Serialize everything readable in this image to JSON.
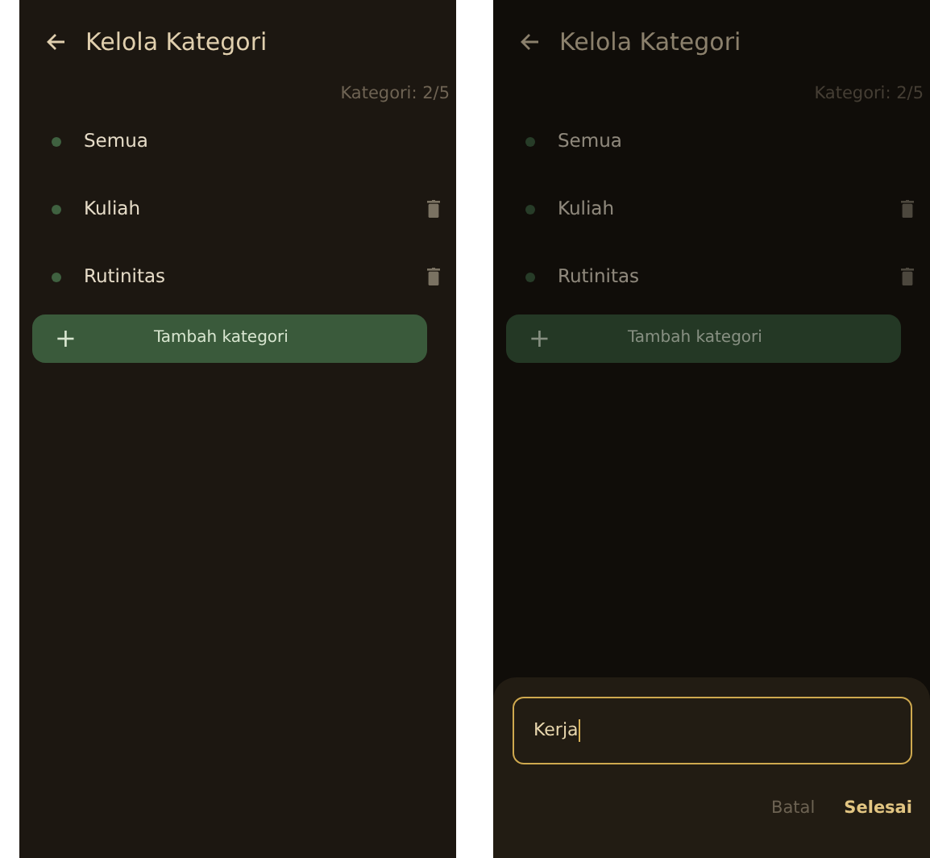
{
  "screens": [
    {
      "title": "Kelola Kategori",
      "counter": "Kategori: 2/5",
      "dimmed": false,
      "categories": [
        {
          "name": "Semua",
          "deletable": false
        },
        {
          "name": "Kuliah",
          "deletable": true
        },
        {
          "name": "Rutinitas",
          "deletable": true
        }
      ],
      "add_button": {
        "icon": "+",
        "label": "Tambah kategori"
      }
    },
    {
      "title": "Kelola Kategori",
      "counter": "Kategori: 2/5",
      "dimmed": true,
      "categories": [
        {
          "name": "Semua",
          "deletable": false
        },
        {
          "name": "Kuliah",
          "deletable": true
        },
        {
          "name": "Rutinitas",
          "deletable": true
        }
      ],
      "add_button": {
        "icon": "+",
        "label": "Tambah kategori"
      },
      "sheet": {
        "input": {
          "value": "Kerja",
          "focused": true
        },
        "buttons": [
          {
            "label": "Batal",
            "kind": "cancel"
          },
          {
            "label": "Selesai",
            "kind": "confirm"
          }
        ]
      }
    }
  ]
}
